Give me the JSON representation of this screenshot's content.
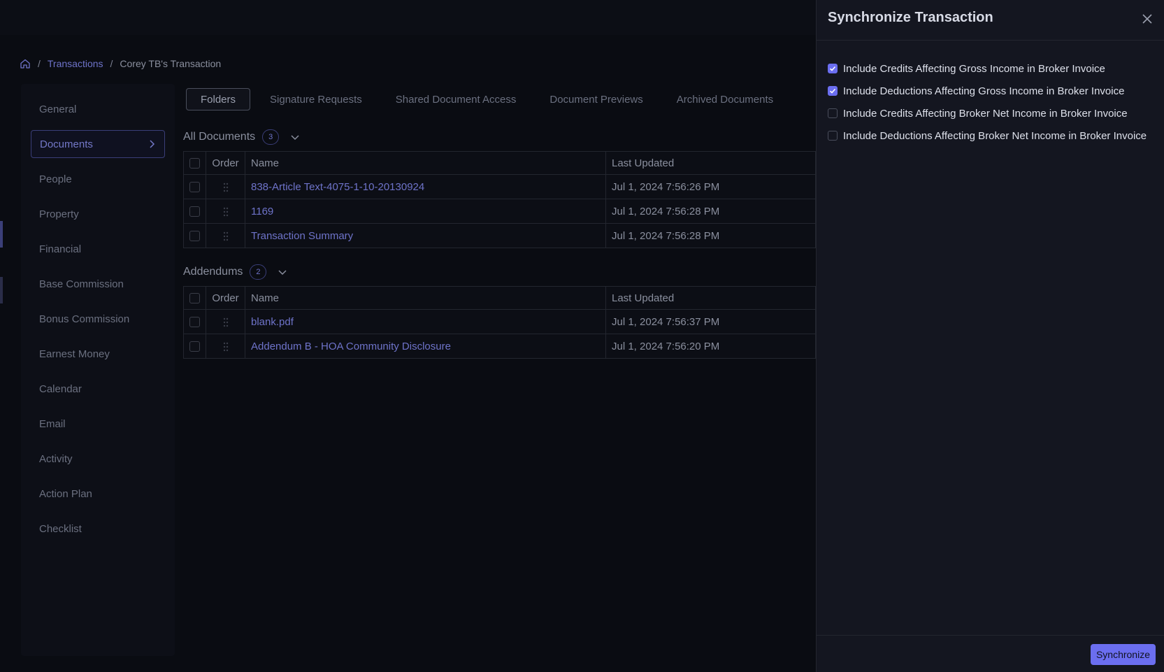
{
  "breadcrumb": {
    "home_icon": "home-icon",
    "separator": "/",
    "transactions": "Transactions",
    "current": "Corey TB's Transaction"
  },
  "sidebar": {
    "items": [
      {
        "label": "General"
      },
      {
        "label": "Documents",
        "active": true
      },
      {
        "label": "People"
      },
      {
        "label": "Property"
      },
      {
        "label": "Financial"
      },
      {
        "label": "Base Commission"
      },
      {
        "label": "Bonus Commission"
      },
      {
        "label": "Earnest Money"
      },
      {
        "label": "Calendar"
      },
      {
        "label": "Email"
      },
      {
        "label": "Activity"
      },
      {
        "label": "Action Plan"
      },
      {
        "label": "Checklist"
      }
    ]
  },
  "tabs": [
    {
      "label": "Folders",
      "active": true
    },
    {
      "label": "Signature Requests"
    },
    {
      "label": "Shared Document Access"
    },
    {
      "label": "Document Previews"
    },
    {
      "label": "Archived Documents"
    }
  ],
  "all_documents": {
    "title": "All Documents",
    "count": "3",
    "columns": {
      "order": "Order",
      "name": "Name",
      "updated": "Last Updated"
    },
    "rows": [
      {
        "name": "838-Article Text-4075-1-10-20130924",
        "updated": "Jul 1, 2024 7:56:26 PM"
      },
      {
        "name": "1169",
        "updated": "Jul 1, 2024 7:56:28 PM"
      },
      {
        "name": "Transaction Summary",
        "updated": "Jul 1, 2024 7:56:28 PM"
      }
    ]
  },
  "addendums": {
    "title": "Addendums",
    "count": "2",
    "columns": {
      "order": "Order",
      "name": "Name",
      "updated": "Last Updated"
    },
    "rows": [
      {
        "name": "blank.pdf",
        "updated": "Jul 1, 2024 7:56:37 PM"
      },
      {
        "name": "Addendum B - HOA Community Disclosure",
        "updated": "Jul 1, 2024 7:56:20 PM"
      }
    ]
  },
  "drawer": {
    "title": "Synchronize Transaction",
    "close_icon": "close-icon",
    "options": [
      {
        "label": "Include Credits Affecting Gross Income in Broker Invoice",
        "checked": true
      },
      {
        "label": "Include Deductions Affecting Gross Income in Broker Invoice",
        "checked": true
      },
      {
        "label": "Include Credits Affecting Broker Net Income in Broker Invoice",
        "checked": false
      },
      {
        "label": "Include Deductions Affecting Broker Net Income in Broker Invoice",
        "checked": false
      }
    ],
    "submit_label": "Synchronize"
  },
  "colors": {
    "accent": "#6b6ef0",
    "link": "#6e73c9",
    "background": "#0a0c12",
    "drawer_bg": "#141620"
  }
}
